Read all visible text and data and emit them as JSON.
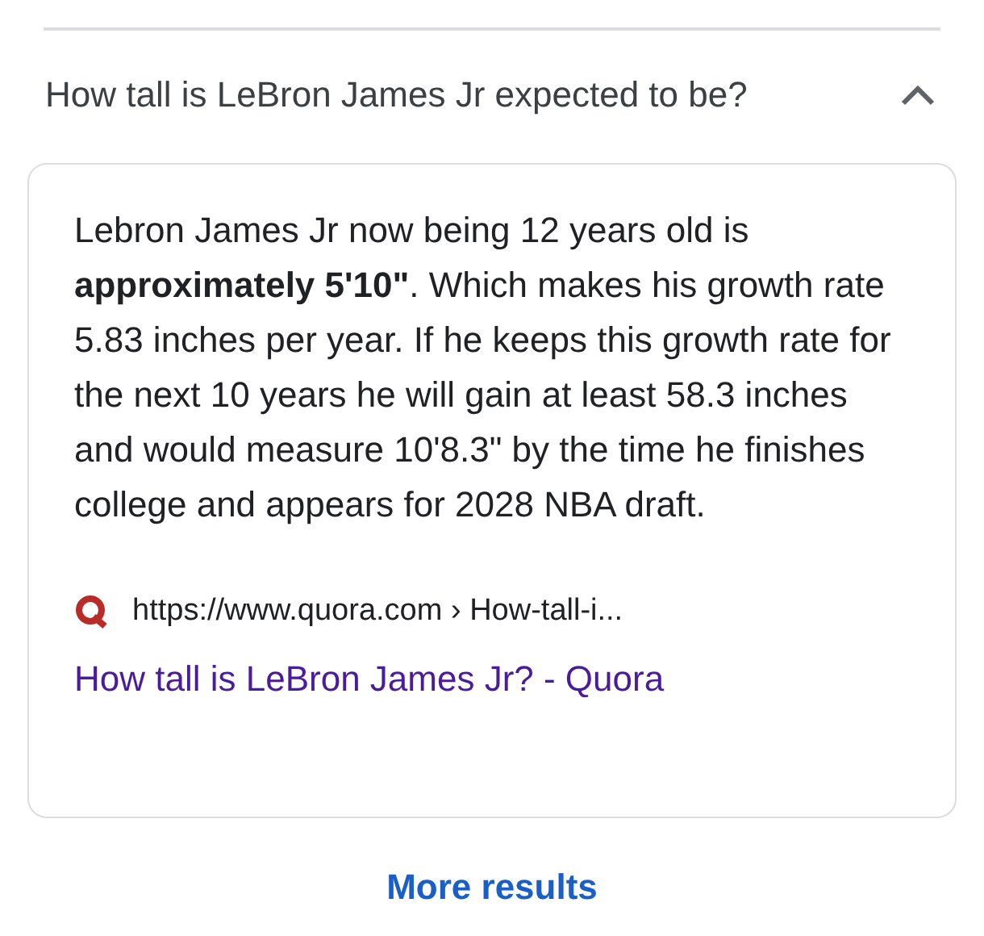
{
  "question": {
    "text": "How tall is LeBron James Jr expected to be?",
    "expanded": true
  },
  "answer": {
    "text": "Lebron James Jr now being 12 years old is **approximately 5'10\"**. Which makes his growth rate 5.83 inches per year. If he keeps this growth rate for the next 10 years he will gain at least 58.3 inches and would measure 10'8.3\" by the time he finishes college and appears for 2028 NBA draft."
  },
  "source": {
    "url": "https://www.quora.com › How-tall-i...",
    "title": "How tall is LeBron James Jr? - Quora"
  },
  "more_results": "More results"
}
